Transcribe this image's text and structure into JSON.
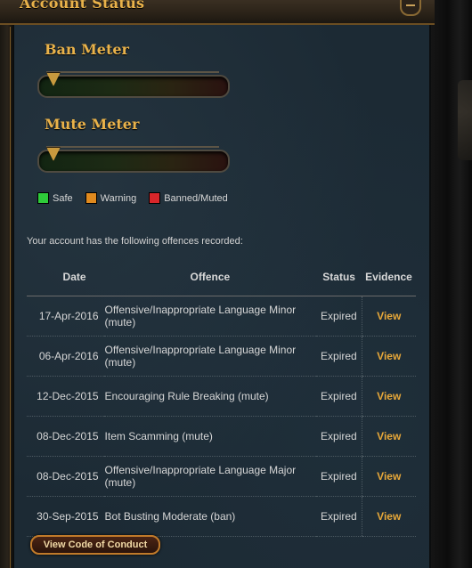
{
  "header": {
    "title": "Account Status"
  },
  "meters": [
    {
      "title": "Ban Meter",
      "level": 0
    },
    {
      "title": "Mute Meter",
      "level": 0
    }
  ],
  "legend": [
    {
      "label": "Safe",
      "color": "#2ecc3a"
    },
    {
      "label": "Warning",
      "color": "#e08a1e"
    },
    {
      "label": "Banned/Muted",
      "color": "#d9262a"
    }
  ],
  "intro": "Your account has the following offences recorded:",
  "table": {
    "headers": {
      "date": "Date",
      "offence": "Offence",
      "status": "Status",
      "evidence": "Evidence"
    },
    "rows": [
      {
        "date": "17-Apr-2016",
        "offence": "Offensive/Inappropriate Language Minor (mute)",
        "status": "Expired",
        "evidence": "View"
      },
      {
        "date": "06-Apr-2016",
        "offence": "Offensive/Inappropriate Language Minor (mute)",
        "status": "Expired",
        "evidence": "View"
      },
      {
        "date": "12-Dec-2015",
        "offence": "Encouraging Rule Breaking (mute)",
        "status": "Expired",
        "evidence": "View"
      },
      {
        "date": "08-Dec-2015",
        "offence": "Item Scamming (mute)",
        "status": "Expired",
        "evidence": "View"
      },
      {
        "date": "08-Dec-2015",
        "offence": "Offensive/Inappropriate Language Major (mute)",
        "status": "Expired",
        "evidence": "View"
      },
      {
        "date": "30-Sep-2015",
        "offence": "Bot Busting Moderate (ban)",
        "status": "Expired",
        "evidence": "View"
      }
    ]
  },
  "buttons": {
    "code_of_conduct": "View Code of Conduct"
  }
}
